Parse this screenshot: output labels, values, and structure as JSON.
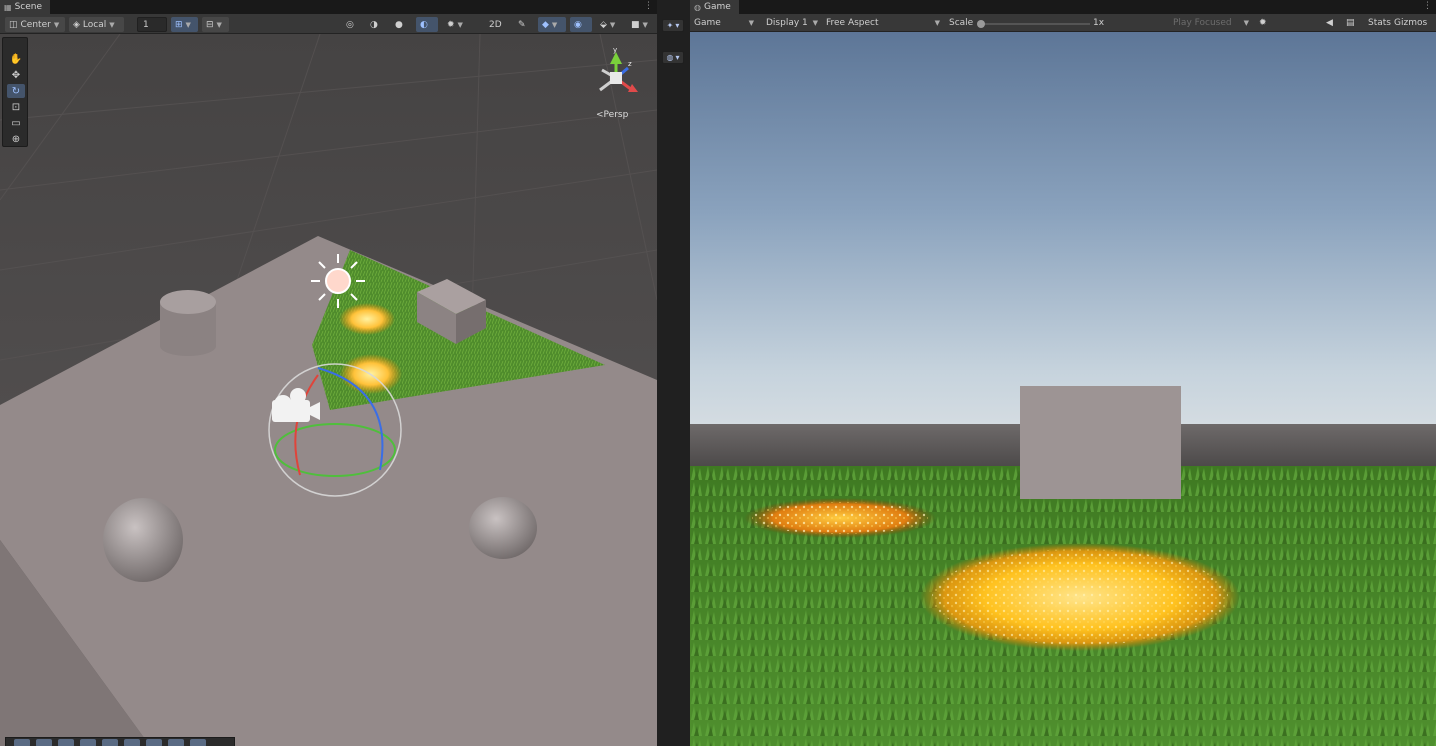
{
  "scene": {
    "tab_label": "Scene",
    "tab_icon": "scene-icon",
    "toolbar": {
      "pivot_mode": "Center",
      "pivot_rotation": "Local",
      "grid_size": "1",
      "view_2d": "2D",
      "camera_mode": "Persp"
    },
    "tools": [
      "hand-tool",
      "move-tool",
      "rotate-tool",
      "scale-tool",
      "rect-tool",
      "transform-tool"
    ],
    "active_tool": "rotate-tool"
  },
  "game": {
    "tab_label": "Game",
    "tab_icon": "game-controller-icon",
    "toolbar": {
      "view_mode": "Game",
      "display": "Display 1",
      "aspect": "Free Aspect",
      "scale_label": "Scale",
      "scale_value": "1x",
      "play_mode": "Play Focused",
      "stats_label": "Stats",
      "gizmos_label": "Gizmos"
    }
  },
  "colors": {
    "accent": "#44546b",
    "accent_text": "#9ec1ff",
    "panel_bg": "#383838",
    "grass": "#4e8a2a",
    "glow": "#ffb82a"
  }
}
